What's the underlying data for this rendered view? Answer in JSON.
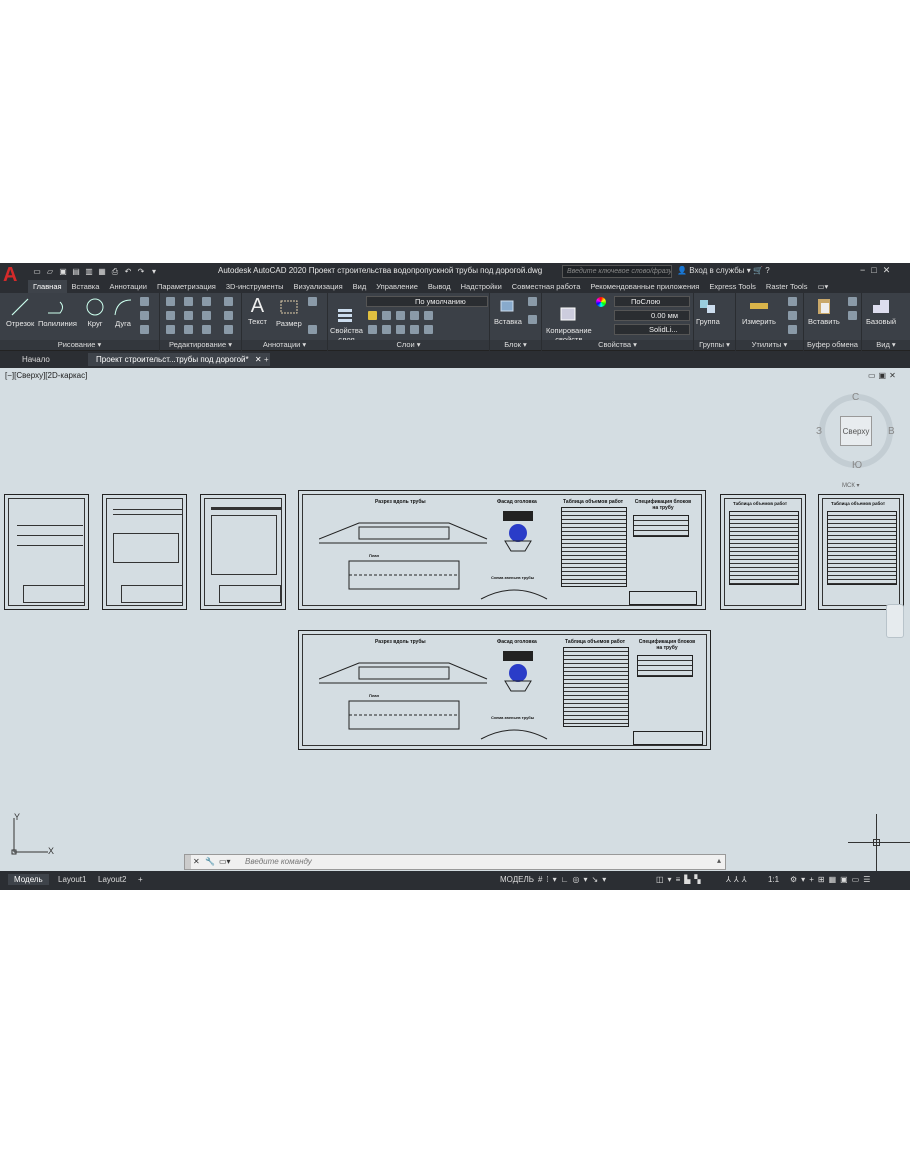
{
  "app": {
    "logo": "A",
    "title": "Autodesk AutoCAD 2020   Проект строительства водопропускной трубы под дорогой.dwg",
    "search_placeholder": "Введите ключевое слово/фразу",
    "login": "Вход в службы"
  },
  "ribbon_tabs": [
    "Главная",
    "Вставка",
    "Аннотации",
    "Параметризация",
    "3D-инструменты",
    "Визуализация",
    "Вид",
    "Управление",
    "Вывод",
    "Надстройки",
    "Совместная работа",
    "Рекомендованные приложения",
    "Express Tools",
    "Raster Tools"
  ],
  "ribbon": {
    "draw": {
      "title": "Рисование ▾",
      "tools": [
        "Отрезок",
        "Полилиния",
        "Круг",
        "Дуга"
      ]
    },
    "modify": {
      "title": "Редактирование ▾"
    },
    "annotation": {
      "title": "Аннотации ▾",
      "tools": [
        "Текст",
        "Размер"
      ]
    },
    "layers": {
      "title": "Слои ▾",
      "props_label": "Свойства\nслоя",
      "layer_value": "По умолчанию"
    },
    "block": {
      "title": "Блок ▾",
      "insert": "Вставка"
    },
    "properties": {
      "title": "Свойства ▾",
      "copy": "Копирование\nсвойств",
      "color": "ПоСлою",
      "lineweight": "0.00 мм",
      "linetype": "SolidLi..."
    },
    "groups": {
      "title": "Группы ▾",
      "group": "Группа"
    },
    "utilities": {
      "title": "Утилиты ▾",
      "measure": "Измерить"
    },
    "clipboard": {
      "title": "Буфер обмена",
      "paste": "Вставить"
    },
    "view": {
      "title": "Вид ▾",
      "base": "Базовый"
    }
  },
  "doc_tabs": {
    "start": "Начало",
    "drawing": "Проект строительст...трубы под дорогой*"
  },
  "viewport": {
    "label": "[−][Сверху][2D-каркас]"
  },
  "viewcube": {
    "top": "Сверху",
    "n": "С",
    "s": "Ю",
    "w": "З",
    "e": "В",
    "wcs": "МСК ▾"
  },
  "ucs": {
    "x": "X",
    "y": "Y"
  },
  "drawing_text": {
    "section_title": "Разрез вдоль трубы",
    "facade": "Фасад оголовка",
    "volumes": "Таблица объемов работ",
    "spec": "Спецификация блоков на трубу",
    "plan": "План",
    "scheme": "Схема звеньев трубы",
    "volumes_a": "Таблица объемов работ"
  },
  "command": {
    "placeholder": "Введите команду"
  },
  "status": {
    "model": "Модель",
    "layout1": "Layout1",
    "layout2": "Layout2",
    "plus": "+",
    "mode": "МОДЕЛЬ",
    "scale": "1:1"
  }
}
